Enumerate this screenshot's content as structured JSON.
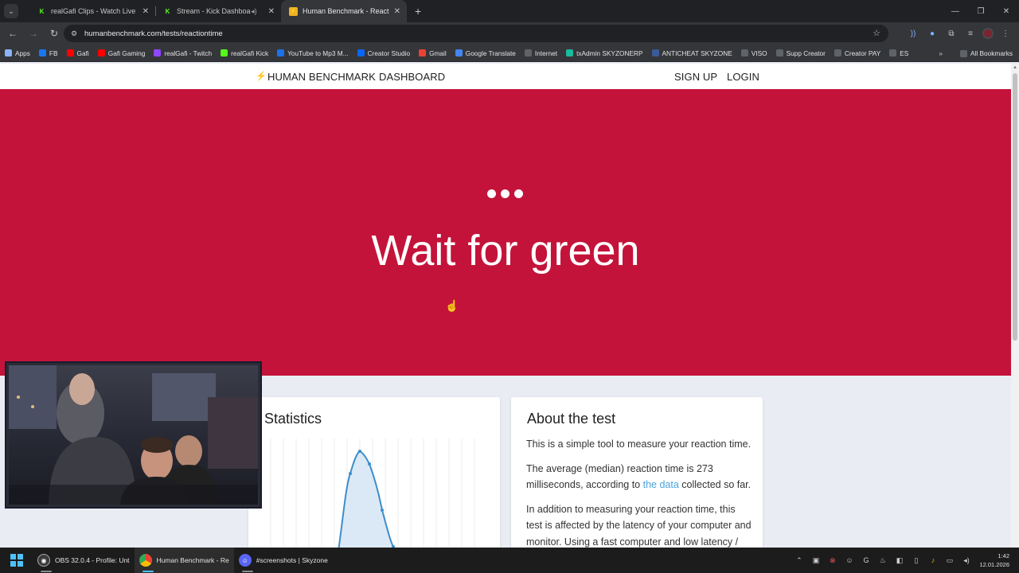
{
  "browser": {
    "tabs": [
      {
        "title": "realGafi Clips - Watch Live on K",
        "favicon": "kick",
        "active": false,
        "audio": false
      },
      {
        "title": "Stream - Kick Dashboard",
        "favicon": "kick",
        "active": false,
        "audio": true
      },
      {
        "title": "Human Benchmark - Reaction T",
        "favicon": "human-benchmark",
        "active": true,
        "audio": false
      }
    ],
    "url": "humanbenchmark.com/tests/reactiontime",
    "bookmarks": [
      {
        "label": "Apps",
        "color": "#8ab4f8"
      },
      {
        "label": "FB",
        "color": "#1877f2"
      },
      {
        "label": "Gafi",
        "color": "#ff0000"
      },
      {
        "label": "Gafi Gaming",
        "color": "#ff0000"
      },
      {
        "label": "realGafi - Twitch",
        "color": "#9146ff"
      },
      {
        "label": "realGafi Kick",
        "color": "#53fc18"
      },
      {
        "label": "YouTube to Mp3 M...",
        "color": "#1a73e8"
      },
      {
        "label": "Creator Studio",
        "color": "#0866ff"
      },
      {
        "label": "Gmail",
        "color": "#ea4335"
      },
      {
        "label": "Google Translate",
        "color": "#4285f4"
      },
      {
        "label": "Internet",
        "color": "#5f6368"
      },
      {
        "label": "txAdmin SKYZONERP",
        "color": "#1abc9c"
      },
      {
        "label": "ANTICHEAT SKYZONE",
        "color": "#3a5a9a"
      },
      {
        "label": "VISO",
        "color": "#5f6368"
      },
      {
        "label": "Supp Creator",
        "color": "#5f6368"
      },
      {
        "label": "Creator PAY",
        "color": "#5f6368"
      },
      {
        "label": "ES",
        "color": "#5f6368"
      }
    ],
    "all_bookmarks": "All Bookmarks"
  },
  "site": {
    "brand": "HUMAN BENCHMARK",
    "dashboard": "DASHBOARD",
    "signup": "SIGN UP",
    "login": "LOGIN",
    "hero_title": "Wait for green",
    "hero_color": "#c4133a"
  },
  "stats": {
    "title": "Statistics"
  },
  "about": {
    "title": "About the test",
    "p1": "This is a simple tool to measure your reaction time.",
    "p2_before": "The average (median) reaction time is 273 milliseconds, according to ",
    "p2_link": "the data",
    "p2_after": " collected so far.",
    "p3": "In addition to measuring your reaction time, this test is affected by the latency of your computer and monitor. Using a fast computer and low latency /"
  },
  "taskbar": {
    "apps": [
      {
        "label": "OBS 32.0.4 - Profile: Unt",
        "color": "#3a3a3a",
        "active": false
      },
      {
        "label": "Human Benchmark - Re",
        "color": "#4285f4",
        "active": true
      },
      {
        "label": "#screenshots | Skyzone",
        "color": "#5865f2",
        "active": false
      }
    ],
    "time": "1:42",
    "date": "12.01.2026"
  }
}
